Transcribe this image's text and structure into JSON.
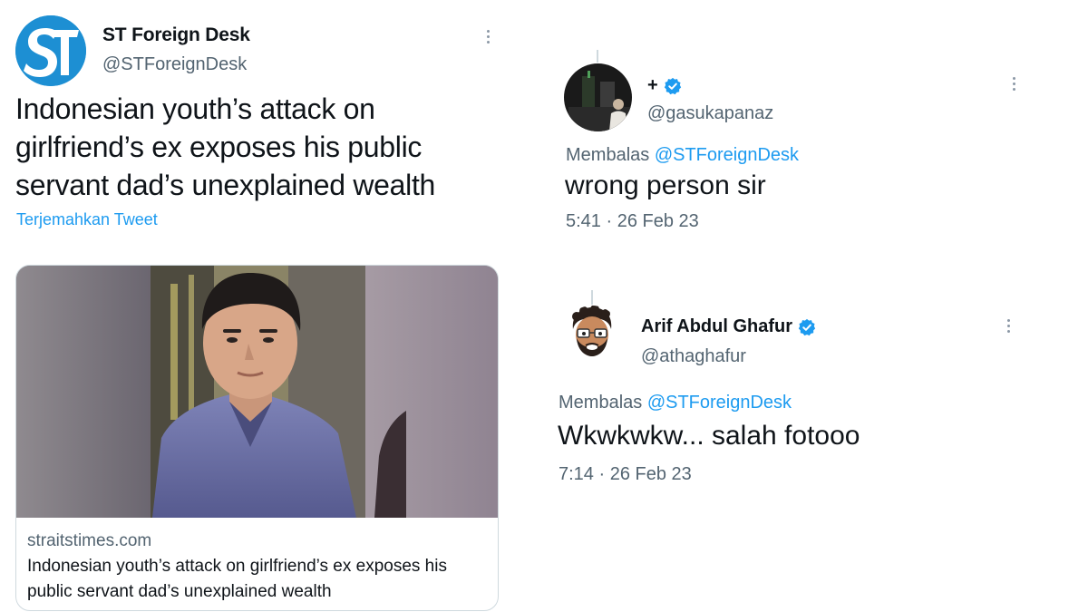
{
  "main_tweet": {
    "account_name": "ST Foreign Desk",
    "handle": "@STForeignDesk",
    "avatar_text": "ST",
    "text": "Indonesian youth’s attack on girlfriend’s ex exposes his public servant dad’s unexplained wealth",
    "translate_label": "Terjemahkan Tweet",
    "card": {
      "domain": "straitstimes.com",
      "title": "Indonesian youth’s attack on girlfriend’s ex exposes his public servant dad’s unexplained wealth"
    }
  },
  "replies": [
    {
      "name": "+",
      "verified": true,
      "handle": "@gasukapanaz",
      "replying_prefix": "Membalas ",
      "replying_to": "@STForeignDesk",
      "text": "wrong person sir",
      "time": "5:41 · 26 Feb 23"
    },
    {
      "name": "Arif Abdul Ghafur",
      "verified": true,
      "handle": "@athaghafur",
      "replying_prefix": "Membalas ",
      "replying_to": "@STForeignDesk",
      "text": "Wkwkwkw... salah fotooo",
      "time": "7:14 · 26 Feb 23"
    }
  ],
  "colors": {
    "link": "#1d9bf0",
    "secondary_text": "#536471",
    "primary_text": "#0f1419",
    "st_brand": "#1d8fd3",
    "verified": "#1d9bf0"
  },
  "icons": [
    "more-options-icon",
    "verified-badge-icon"
  ]
}
